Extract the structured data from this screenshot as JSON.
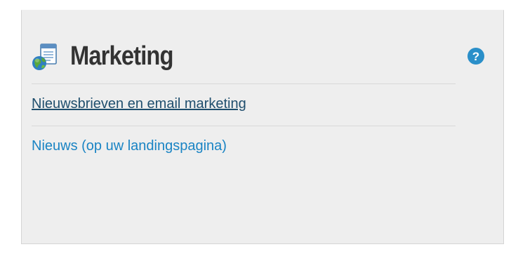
{
  "panel": {
    "title": "Marketing",
    "title_icon": "newsletter-globe-icon",
    "help_icon": "help-question-icon",
    "links": [
      {
        "label": "Nieuwsbrieven en email marketing",
        "state": "hovered"
      },
      {
        "label": "Nieuws (op uw landingspagina)",
        "state": "normal"
      }
    ]
  },
  "colors": {
    "panel_background": "#eeeeee",
    "title": "#333333",
    "link": "#1a84c4",
    "link_hover": "#1f4e6d",
    "help_icon": "#2a8fc9"
  }
}
